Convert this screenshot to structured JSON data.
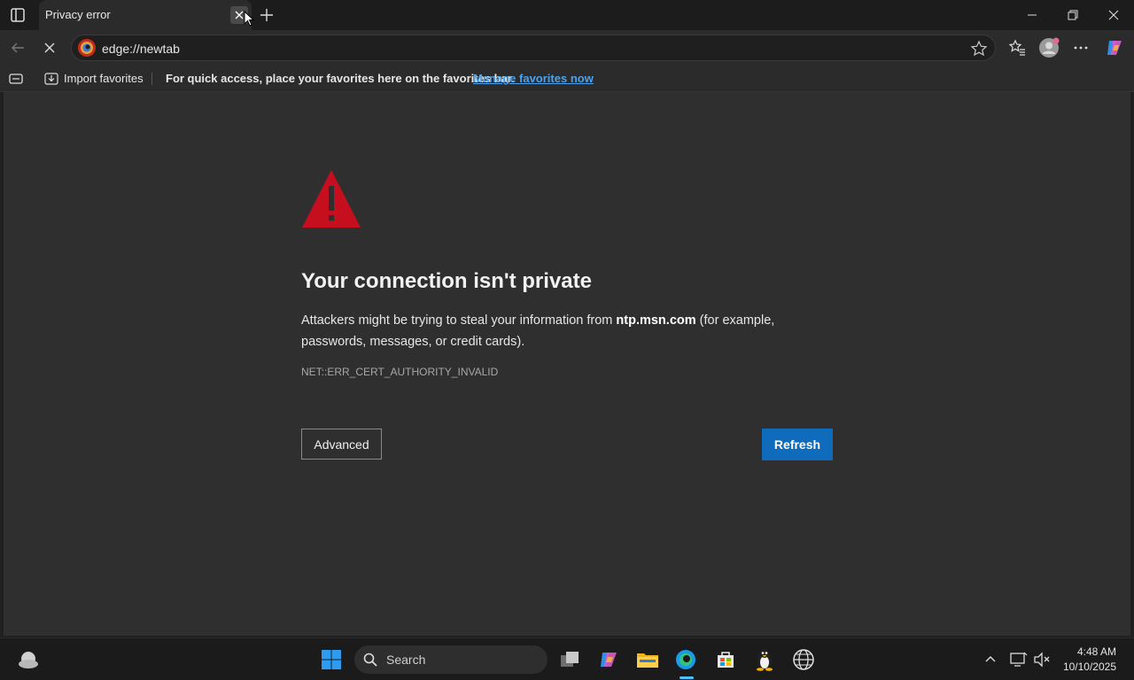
{
  "tab": {
    "title": "Privacy error"
  },
  "address": {
    "url": "edge://newtab"
  },
  "favorites_bar": {
    "import_label": "Import favorites",
    "hint": "For quick access, place your favorites here on the favorites bar.",
    "manage_link": "Manage favorites now"
  },
  "error_page": {
    "heading": "Your connection isn't private",
    "desc_prefix": "Attackers might be trying to steal your information from ",
    "host": "ntp.msn.com",
    "desc_suffix": " (for example, passwords, messages, or credit cards).",
    "code": "NET::ERR_CERT_AUTHORITY_INVALID",
    "advanced_label": "Advanced",
    "refresh_label": "Refresh"
  },
  "taskbar": {
    "search_label": "Search",
    "time": "4:48 AM",
    "date": "10/10/2025"
  },
  "colors": {
    "warning_red": "#c50f1f",
    "accent_blue": "#0f6cbd",
    "link_blue": "#4aa3f0"
  }
}
